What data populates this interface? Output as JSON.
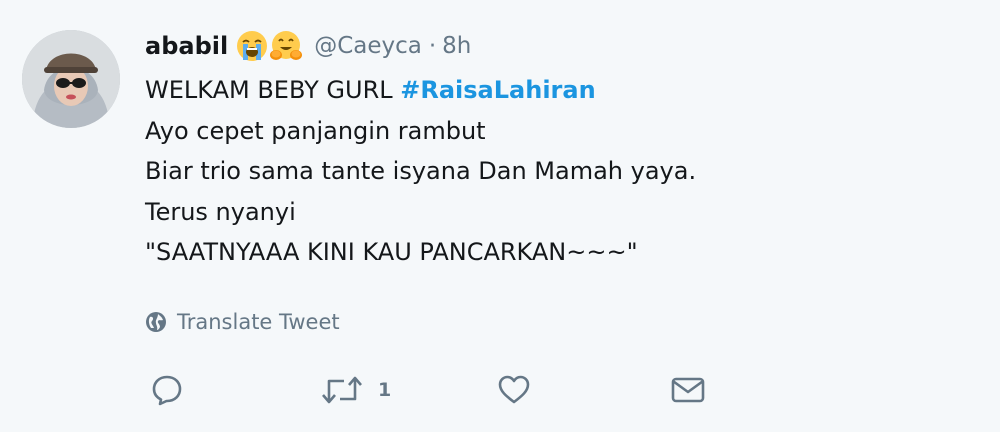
{
  "tweet": {
    "user": {
      "display_name": "ababil",
      "emojis": [
        "loudly-crying-face-emoji",
        "hugging-face-emoji"
      ],
      "handle": "@Caeyca",
      "separator": "·",
      "time": "8h"
    },
    "lines": [
      {
        "text": "WELKAM BEBY GURL ",
        "hashtag": "#RaisaLahiran"
      },
      {
        "text": "Ayo cepet panjangin rambut"
      },
      {
        "text": "Biar trio sama tante isyana Dan Mamah yaya."
      },
      {
        "text": "Terus nyanyi"
      },
      {
        "text": "\"SAATNYAAA KINI KAU PANCARKAN~~~\""
      }
    ],
    "translate_label": "Translate Tweet",
    "actions": {
      "reply_count": "",
      "retweet_count": "1",
      "like_count": ""
    },
    "colors": {
      "background": "#f5f8fa",
      "text": "#14171a",
      "secondary": "#657786",
      "hashtag": "#1b95e0"
    }
  }
}
